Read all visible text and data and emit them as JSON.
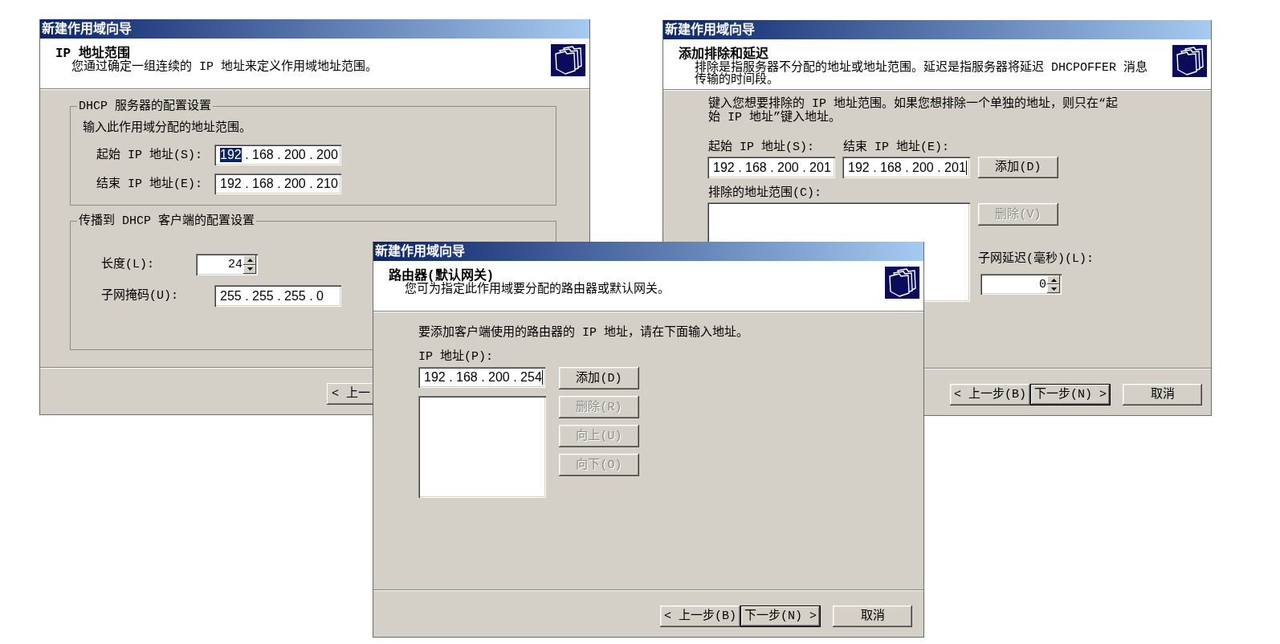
{
  "windows": [
    {
      "kind": "range",
      "title": "新建作用域向导",
      "heading": "IP 地址范围",
      "description": "您通过确定一组连续的 IP 地址来定义作用域地址范围。",
      "groups": [
        {
          "legend": "DHCP 服务器的配置设置",
          "intro": "输入此作用域分配的地址范围。",
          "fields": [
            {
              "kind": "ip",
              "label": "起始 IP 地址(S):",
              "segments": [
                {
                  "text": "192",
                  "selected": true
                },
                {
                  "text": " . 168 . 200 . 200",
                  "selected": false
                }
              ],
              "caret": false
            },
            {
              "kind": "ip",
              "label": "结束 IP 地址(E):",
              "segments": [
                {
                  "text": "192 . 168 . 200 . 210",
                  "selected": false
                }
              ],
              "caret": false
            }
          ]
        },
        {
          "legend": "传播到 DHCP 客户端的配置设置",
          "fields": [
            {
              "kind": "spin",
              "label": "长度(L):",
              "value": "24"
            },
            {
              "kind": "ip",
              "label": "子网掩码(U):",
              "segments": [
                {
                  "text": "255 . 255 . 255 . 0",
                  "selected": false
                }
              ],
              "caret": false
            }
          ]
        }
      ],
      "footer_buttons": [
        {
          "label": "< 上一",
          "default": false
        }
      ]
    },
    {
      "kind": "exclusions",
      "title": "新建作用域向导",
      "heading": "添加排除和延迟",
      "description": "排除是指服务器不分配的地址或地址范围。延迟是指服务器将延迟 DHCPOFFER 消息传输的时间段。",
      "instruction": "键入您想要排除的 IP 地址范围。如果您想排除一个单独的地址，则只在“起始 IP 地址”键入地址。",
      "start": {
        "label": "起始 IP 地址(S):",
        "segments": [
          {
            "text": "192 . 168 . 200 . 201",
            "selected": false
          }
        ],
        "caret": false
      },
      "end": {
        "label": "结束 IP 地址(E):",
        "segments": [
          {
            "text": "192 . 168 . 200 . 201",
            "selected": false
          }
        ],
        "caret": true
      },
      "add_button": {
        "label": "添加(D)",
        "disabled": false
      },
      "list_label": "排除的地址范围(C):",
      "remove_button": {
        "label": "删除(V)",
        "disabled": true
      },
      "delay": {
        "label": "子网延迟(毫秒)(L):",
        "value": "0"
      },
      "footer_buttons": [
        {
          "label": "< 上一步(B)",
          "default": false
        },
        {
          "label": "下一步(N) >",
          "default": true
        },
        {
          "label": "取消",
          "default": false
        }
      ]
    },
    {
      "kind": "router",
      "title": "新建作用域向导",
      "heading": "路由器(默认网关)",
      "description": "您可为指定此作用域要分配的路由器或默认网关。",
      "instruction": "要添加客户端使用的路由器的 IP 地址，请在下面输入地址。",
      "ip": {
        "label": "IP 地址(P):",
        "segments": [
          {
            "text": "192 . 168 . 200 . 254",
            "selected": false
          }
        ],
        "caret": true
      },
      "buttons": [
        {
          "label": "添加(D)",
          "disabled": false
        },
        {
          "label": "删除(R)",
          "disabled": true
        },
        {
          "label": "向上(U)",
          "disabled": true
        },
        {
          "label": "向下(O)",
          "disabled": true
        }
      ],
      "footer_buttons": [
        {
          "label": "< 上一步(B)",
          "default": false
        },
        {
          "label": "下一步(N) >",
          "default": true
        },
        {
          "label": "取消",
          "default": false
        }
      ]
    }
  ]
}
